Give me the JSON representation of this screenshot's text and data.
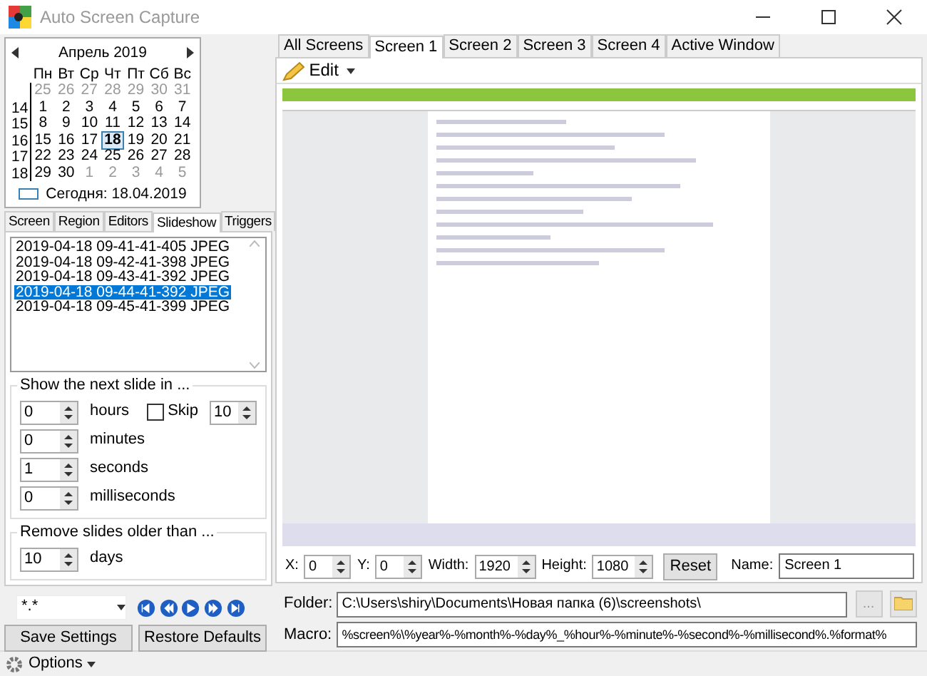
{
  "window": {
    "title": "Auto Screen Capture"
  },
  "calendar": {
    "month": "Апрель 2019",
    "weekdays": [
      "Пн",
      "Вт",
      "Ср",
      "Чт",
      "Пт",
      "Сб",
      "Вс"
    ],
    "weeks": [
      {
        "days": [
          {
            "day": "25",
            "other_month": true,
            "selected": false
          },
          {
            "day": "26",
            "other_month": true,
            "selected": false
          },
          {
            "day": "27",
            "other_month": true,
            "selected": false
          },
          {
            "day": "28",
            "other_month": true,
            "selected": false
          },
          {
            "day": "29",
            "other_month": true,
            "selected": false
          },
          {
            "day": "30",
            "other_month": true,
            "selected": false
          },
          {
            "day": "31",
            "other_month": true,
            "selected": false
          }
        ]
      },
      {
        "week": "14",
        "days": [
          {
            "day": "1",
            "other_month": false,
            "selected": false
          },
          {
            "day": "2",
            "other_month": false,
            "selected": false
          },
          {
            "day": "3",
            "other_month": false,
            "selected": false
          },
          {
            "day": "4",
            "other_month": false,
            "selected": false
          },
          {
            "day": "5",
            "other_month": false,
            "selected": false
          },
          {
            "day": "6",
            "other_month": false,
            "selected": false
          },
          {
            "day": "7",
            "other_month": false,
            "selected": false
          }
        ]
      },
      {
        "week": "15",
        "days": [
          {
            "day": "8",
            "other_month": false,
            "selected": false
          },
          {
            "day": "9",
            "other_month": false,
            "selected": false
          },
          {
            "day": "10",
            "other_month": false,
            "selected": false
          },
          {
            "day": "11",
            "other_month": false,
            "selected": false
          },
          {
            "day": "12",
            "other_month": false,
            "selected": false
          },
          {
            "day": "13",
            "other_month": false,
            "selected": false
          },
          {
            "day": "14",
            "other_month": false,
            "selected": false
          }
        ]
      },
      {
        "week": "16",
        "days": [
          {
            "day": "15",
            "other_month": false,
            "selected": false
          },
          {
            "day": "16",
            "other_month": false,
            "selected": false
          },
          {
            "day": "17",
            "other_month": false,
            "selected": false
          },
          {
            "day": "18",
            "other_month": false,
            "selected": true
          },
          {
            "day": "19",
            "other_month": false,
            "selected": false
          },
          {
            "day": "20",
            "other_month": false,
            "selected": false
          },
          {
            "day": "21",
            "other_month": false,
            "selected": false
          }
        ]
      },
      {
        "week": "17",
        "days": [
          {
            "day": "22",
            "other_month": false,
            "selected": false
          },
          {
            "day": "23",
            "other_month": false,
            "selected": false
          },
          {
            "day": "24",
            "other_month": false,
            "selected": false
          },
          {
            "day": "25",
            "other_month": false,
            "selected": false
          },
          {
            "day": "26",
            "other_month": false,
            "selected": false
          },
          {
            "day": "27",
            "other_month": false,
            "selected": false
          },
          {
            "day": "28",
            "other_month": false,
            "selected": false
          }
        ]
      },
      {
        "week": "18",
        "days": [
          {
            "day": "29",
            "other_month": false,
            "selected": false
          },
          {
            "day": "30",
            "other_month": false,
            "selected": false
          },
          {
            "day": "1",
            "other_month": true,
            "selected": false
          },
          {
            "day": "2",
            "other_month": true,
            "selected": false
          },
          {
            "day": "3",
            "other_month": true,
            "selected": false
          },
          {
            "day": "4",
            "other_month": true,
            "selected": false
          },
          {
            "day": "5",
            "other_month": true,
            "selected": false
          }
        ]
      }
    ],
    "today": "Сегодня: 18.04.2019"
  },
  "left_tabs": [
    {
      "label": "Screen",
      "selected": false
    },
    {
      "label": "Region",
      "selected": false
    },
    {
      "label": "Editors",
      "selected": false
    },
    {
      "label": "Slideshow",
      "selected": true
    },
    {
      "label": "Triggers",
      "selected": false
    }
  ],
  "slides": [
    {
      "label": "2019-04-18 09-41-41-405 JPEG",
      "selected": false
    },
    {
      "label": "2019-04-18 09-42-41-398 JPEG",
      "selected": false
    },
    {
      "label": "2019-04-18 09-43-41-392 JPEG",
      "selected": false
    },
    {
      "label": "2019-04-18 09-44-41-392 JPEG",
      "selected": true
    },
    {
      "label": "2019-04-18 09-45-41-399 JPEG",
      "selected": false
    }
  ],
  "next_slide": {
    "title": "Show the next slide in ...",
    "fields": [
      {
        "value": "0",
        "unit": "hours"
      },
      {
        "value": "0",
        "unit": "minutes"
      },
      {
        "value": "1",
        "unit": "seconds"
      },
      {
        "value": "0",
        "unit": "milliseconds"
      }
    ],
    "skip": {
      "label": "Skip",
      "checked": false,
      "value": "10"
    }
  },
  "remove_slides": {
    "title": "Remove slides older than ...",
    "value": "10",
    "unit": "days"
  },
  "filter": {
    "value": "*.*"
  },
  "buttons": [
    "Save Settings",
    "Restore Defaults"
  ],
  "status_bar": {
    "options": "Options"
  },
  "screen_tabs": [
    {
      "label": "All Screens",
      "selected": false
    },
    {
      "label": "Screen 1",
      "selected": true
    },
    {
      "label": "Screen 2",
      "selected": false
    },
    {
      "label": "Screen 3",
      "selected": false
    },
    {
      "label": "Screen 4",
      "selected": false
    },
    {
      "label": "Active Window",
      "selected": false
    }
  ],
  "toolbar": {
    "edit": "Edit"
  },
  "region": {
    "fields": [
      {
        "label": "X:",
        "value": "0"
      },
      {
        "label": "Y:",
        "value": "0"
      },
      {
        "label": "Width:",
        "value": "1920"
      },
      {
        "label": "Height:",
        "value": "1080"
      }
    ],
    "reset": "Reset",
    "name_label": "Name:",
    "name": "Screen 1"
  },
  "folder": {
    "label": "Folder:",
    "value": "C:\\Users\\shiry\\Documents\\Новая папка (6)\\screenshots\\",
    "browse": "..."
  },
  "macro": {
    "label": "Macro:",
    "value": "%screen%\\%year%-%month%-%day%_%hour%-%minute%-%second%-%millisecond%.%format%"
  }
}
